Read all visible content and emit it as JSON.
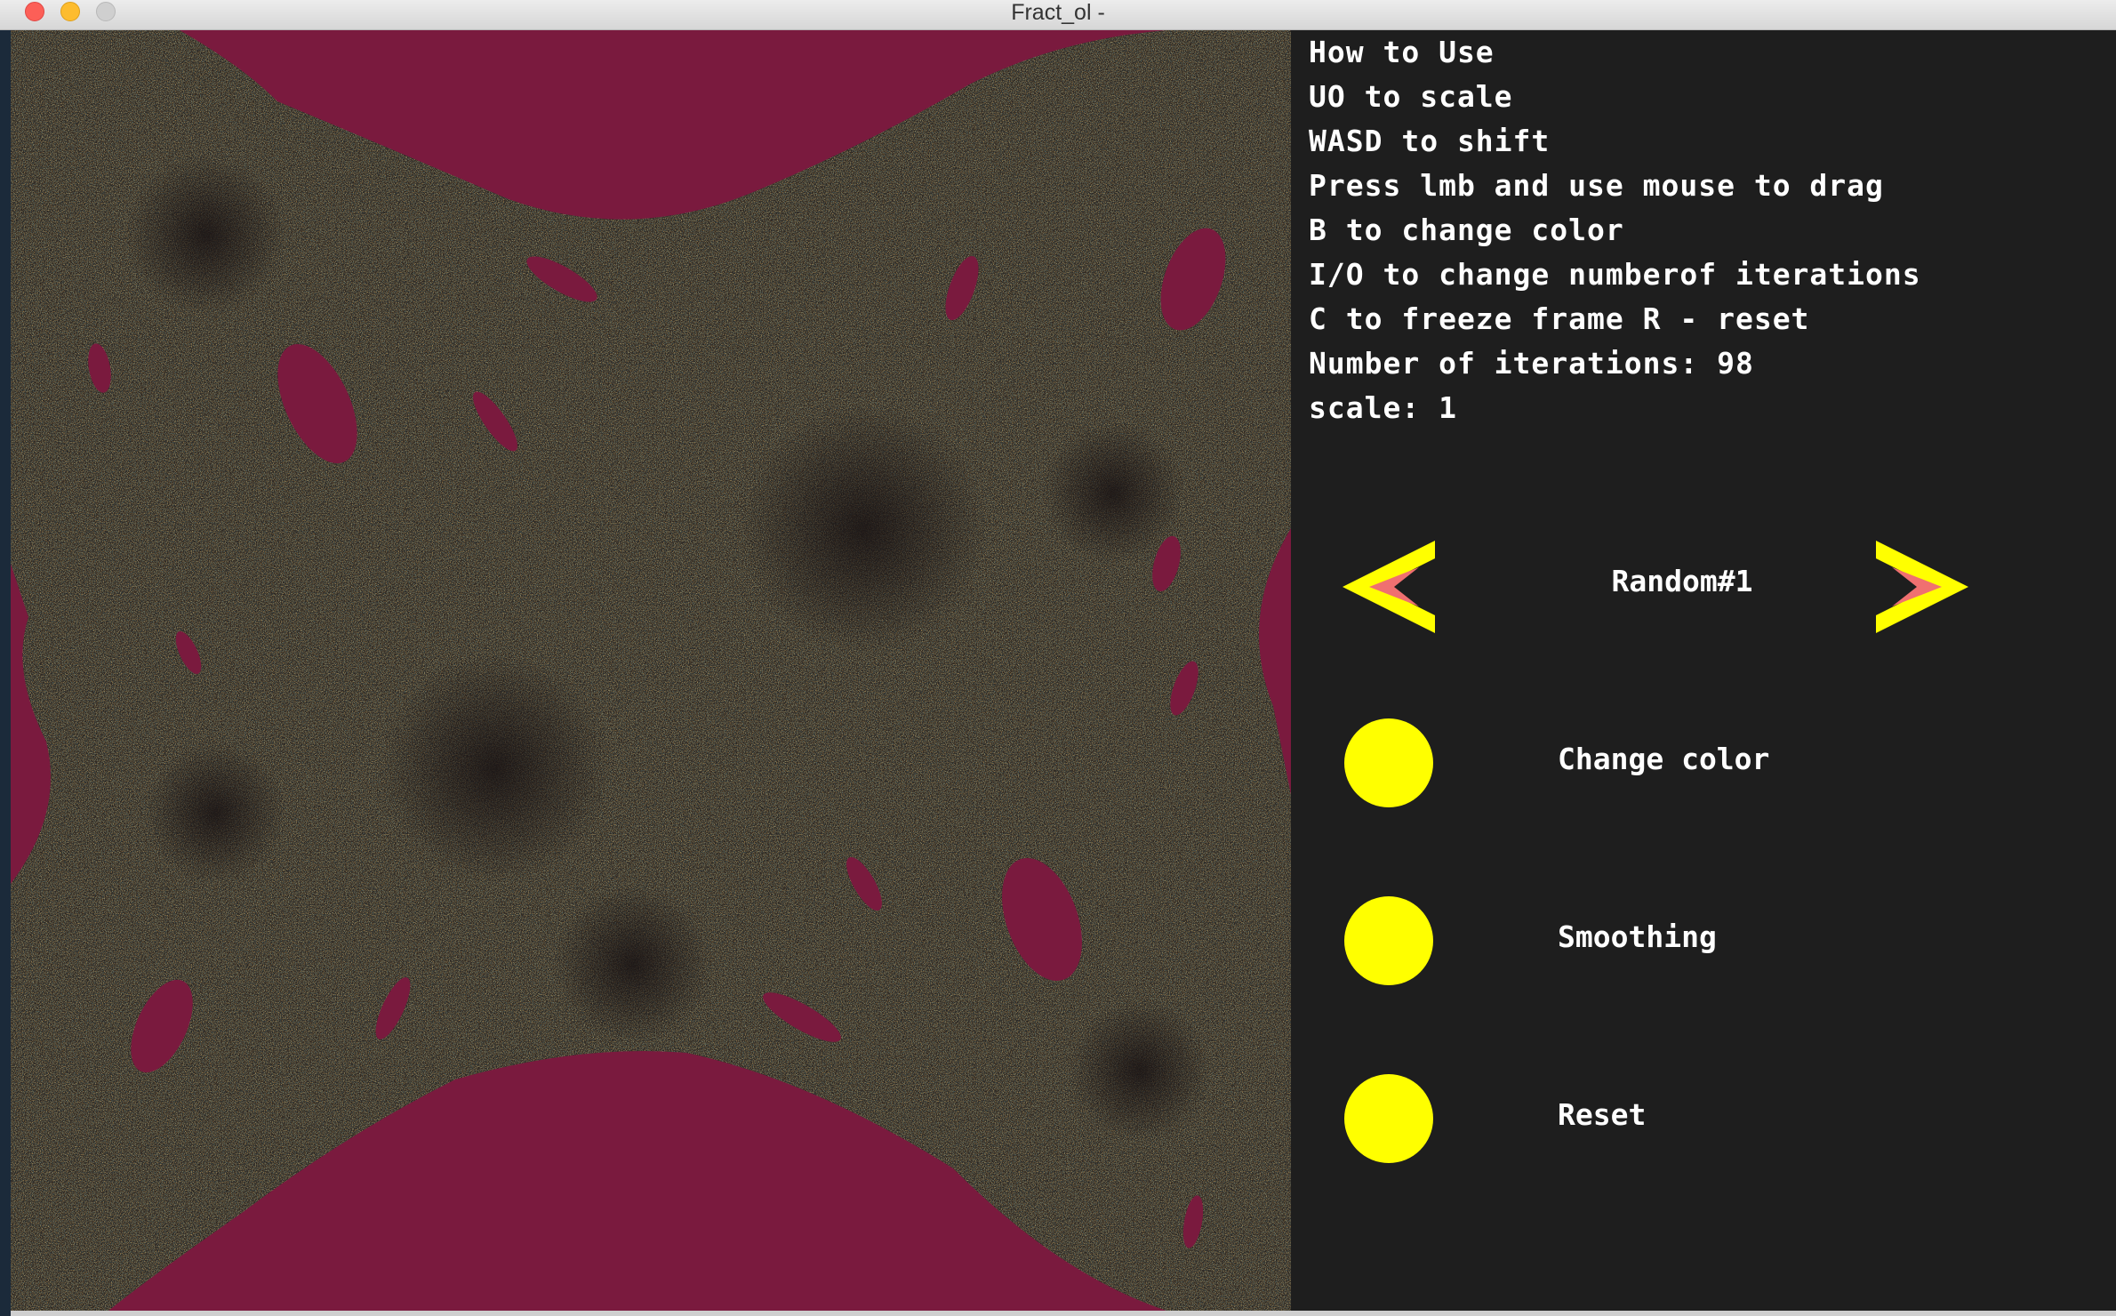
{
  "window": {
    "title": "Fract_ol -"
  },
  "help": {
    "lines": [
      "How to Use",
      "UO to scale",
      "WASD to shift",
      "Press lmb and use mouse to drag",
      "B to change color",
      "I/O to change numberof iterations",
      "C to freeze frame R - reset",
      "Number of iterations: 98",
      "scale: 1"
    ]
  },
  "preset": {
    "label": "Random#1",
    "prev_icon": "chevron-left-icon",
    "next_icon": "chevron-right-icon"
  },
  "buttons": {
    "change_color": "Change color",
    "smoothing": "Smoothing",
    "reset": "Reset"
  },
  "colors": {
    "accent_yellow": "#ffff00",
    "arrow_inner": "#f07070",
    "fractal_background": "#7a1a3e",
    "panel_background": "#1e1e1e",
    "fractal_orange": "#e8902a",
    "fractal_teal": "#3c8c8c"
  }
}
